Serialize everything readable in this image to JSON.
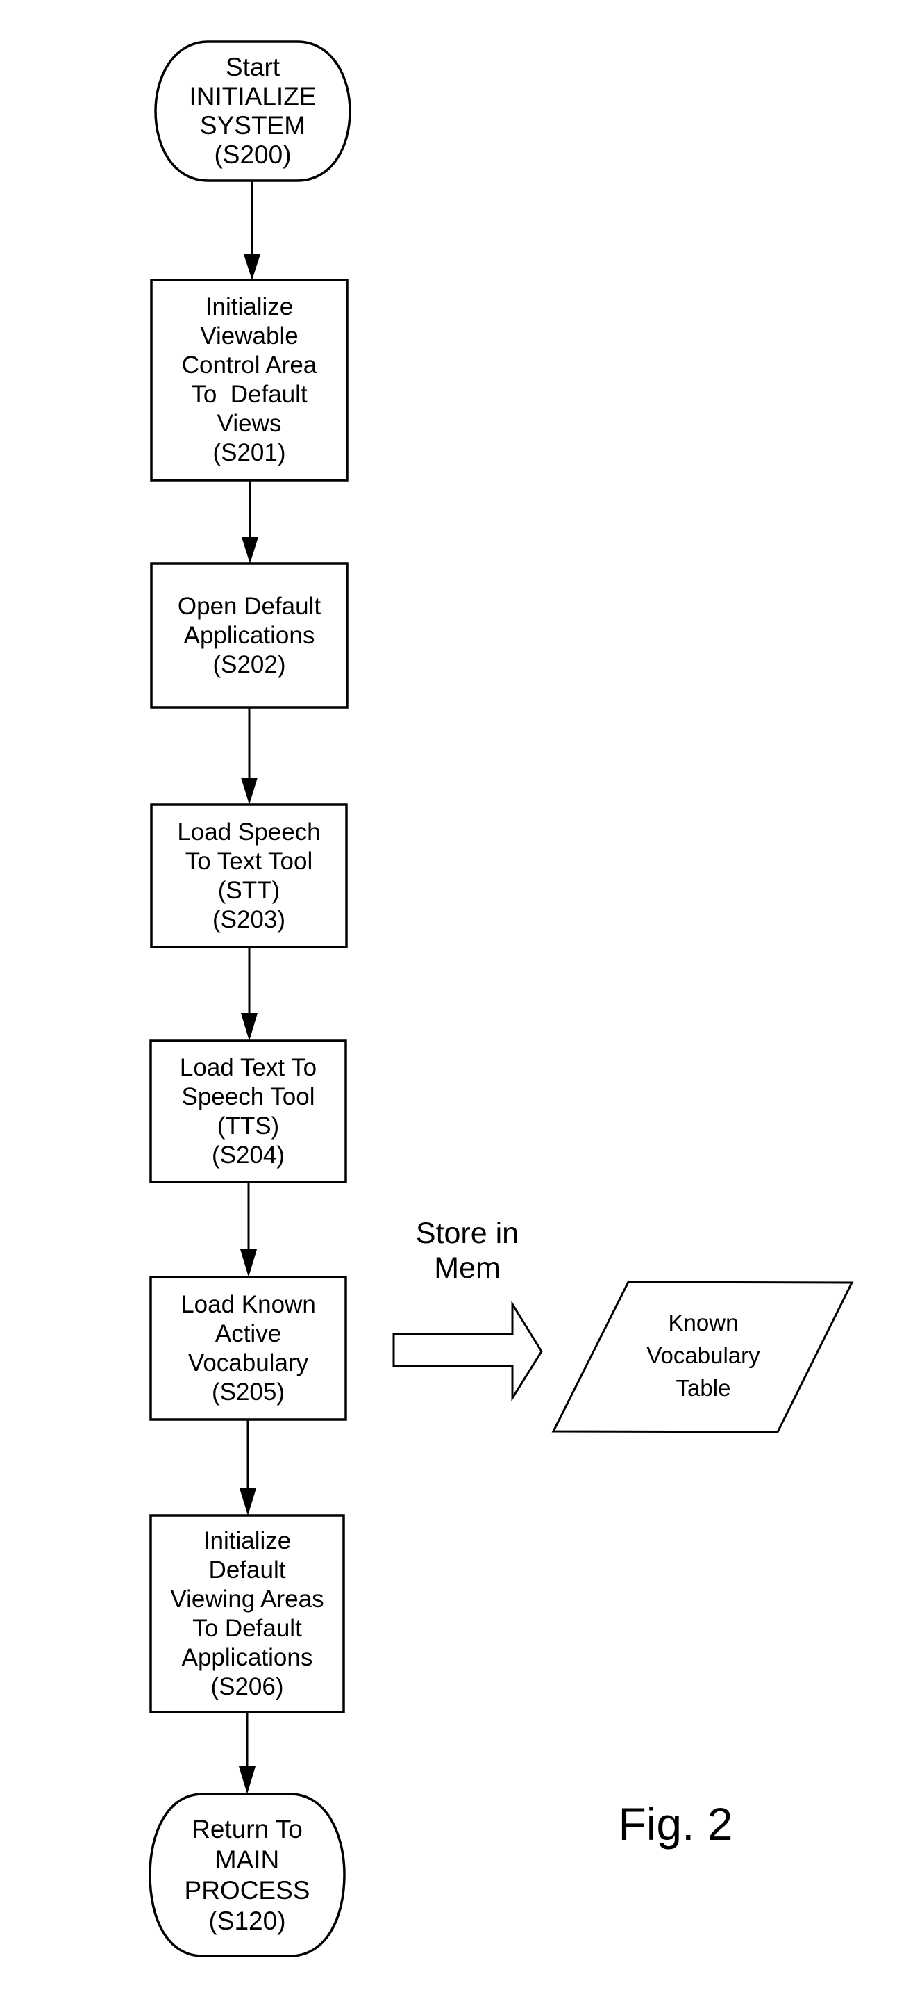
{
  "figure": {
    "caption": "Fig. 2"
  },
  "flowchart": {
    "nodes": [
      {
        "id": "S200",
        "shape": "terminal",
        "lines": [
          "Start",
          "INITIALIZE",
          "SYSTEM",
          "(S200)"
        ]
      },
      {
        "id": "S201",
        "shape": "process",
        "lines": [
          "Initialize",
          "Viewable",
          "Control Area",
          "To  Default",
          "Views",
          "(S201)"
        ]
      },
      {
        "id": "S202",
        "shape": "process",
        "lines": [
          "Open Default",
          "Applications",
          "(S202)"
        ]
      },
      {
        "id": "S203",
        "shape": "process",
        "lines": [
          "Load Speech",
          "To Text Tool",
          "(STT)",
          "(S203)"
        ]
      },
      {
        "id": "S204",
        "shape": "process",
        "lines": [
          "Load Text To",
          "Speech Tool",
          "(TTS)",
          "(S204)"
        ]
      },
      {
        "id": "S205",
        "shape": "process",
        "lines": [
          "Load Known",
          "Active",
          "Vocabulary",
          "(S205)"
        ]
      },
      {
        "id": "S206",
        "shape": "process",
        "lines": [
          "Initialize",
          "Default",
          "Viewing Areas",
          "To Default",
          "Applications",
          "(S206)"
        ]
      },
      {
        "id": "S120",
        "shape": "terminal",
        "lines": [
          "Return To",
          "MAIN",
          "PROCESS",
          "(S120)"
        ]
      }
    ],
    "edges": [
      {
        "from": "S200",
        "to": "S201"
      },
      {
        "from": "S201",
        "to": "S202"
      },
      {
        "from": "S202",
        "to": "S203"
      },
      {
        "from": "S203",
        "to": "S204"
      },
      {
        "from": "S204",
        "to": "S205"
      },
      {
        "from": "S205",
        "to": "S206"
      },
      {
        "from": "S206",
        "to": "S120"
      }
    ],
    "side_flow": {
      "from": "S205",
      "arrow_label_lines": [
        "Store in",
        "Mem"
      ],
      "arrow_style": "hollow-block-arrow",
      "target": {
        "shape": "data-parallelogram",
        "lines": [
          "Known",
          "Vocabulary",
          "Table"
        ]
      }
    }
  },
  "colors": {
    "stroke": "#000000",
    "background": "#ffffff"
  }
}
